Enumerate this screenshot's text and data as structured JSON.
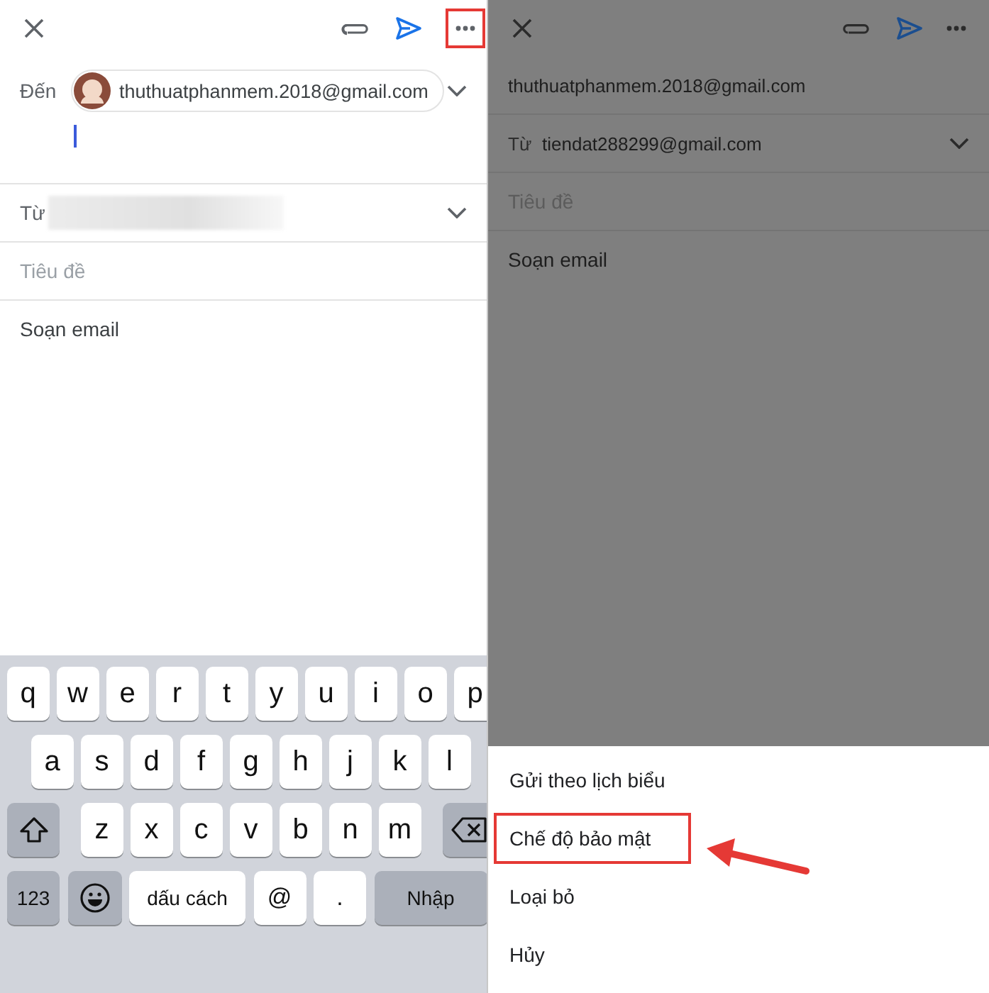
{
  "left_screen": {
    "toolbar": {
      "more_highlighted": true
    },
    "to": {
      "label": "Đến",
      "chip": "thuthuatphanmem.2018@gmail.com"
    },
    "from": {
      "label": "Từ"
    },
    "subject": {
      "placeholder": "Tiêu đề"
    },
    "body": {
      "placeholder": "Soạn email"
    },
    "keyboard": {
      "rows": [
        {
          "keys": [
            {
              "kind": "letter",
              "label": "q"
            },
            {
              "kind": "letter",
              "label": "w"
            },
            {
              "kind": "letter",
              "label": "e"
            },
            {
              "kind": "letter",
              "label": "r"
            },
            {
              "kind": "letter",
              "label": "t"
            },
            {
              "kind": "letter",
              "label": "y"
            },
            {
              "kind": "letter",
              "label": "u"
            },
            {
              "kind": "letter",
              "label": "i"
            },
            {
              "kind": "letter",
              "label": "o"
            },
            {
              "kind": "letter",
              "label": "p"
            }
          ]
        },
        {
          "keys": [
            {
              "kind": "letter",
              "label": "a"
            },
            {
              "kind": "letter",
              "label": "s"
            },
            {
              "kind": "letter",
              "label": "d"
            },
            {
              "kind": "letter",
              "label": "f"
            },
            {
              "kind": "letter",
              "label": "g"
            },
            {
              "kind": "letter",
              "label": "h"
            },
            {
              "kind": "letter",
              "label": "j"
            },
            {
              "kind": "letter",
              "label": "k"
            },
            {
              "kind": "letter",
              "label": "l"
            }
          ]
        },
        {
          "keys": [
            {
              "kind": "shift"
            },
            {
              "kind": "letter",
              "label": "z"
            },
            {
              "kind": "letter",
              "label": "x"
            },
            {
              "kind": "letter",
              "label": "c"
            },
            {
              "kind": "letter",
              "label": "v"
            },
            {
              "kind": "letter",
              "label": "b"
            },
            {
              "kind": "letter",
              "label": "n"
            },
            {
              "kind": "letter",
              "label": "m"
            },
            {
              "kind": "backspace"
            }
          ]
        },
        {
          "keys": [
            {
              "kind": "function",
              "label": "123"
            },
            {
              "kind": "emoji"
            },
            {
              "kind": "space",
              "label": "dấu cách"
            },
            {
              "kind": "symbol",
              "label": "@"
            },
            {
              "kind": "symbol",
              "label": "."
            },
            {
              "kind": "enter",
              "label": "Nhập"
            }
          ]
        }
      ]
    }
  },
  "right_screen": {
    "to": {
      "value": "thuthuatphanmem.2018@gmail.com"
    },
    "from": {
      "label": "Từ",
      "value": "tiendat288299@gmail.com"
    },
    "subject": {
      "placeholder": "Tiêu đề"
    },
    "body": {
      "placeholder": "Soạn email"
    },
    "menu": [
      {
        "label": "Gửi theo lịch biểu",
        "highlighted": false
      },
      {
        "label": "Chế độ bảo mật",
        "highlighted": true
      },
      {
        "label": "Loại bỏ",
        "highlighted": false
      },
      {
        "label": "Hủy",
        "highlighted": false
      }
    ]
  }
}
